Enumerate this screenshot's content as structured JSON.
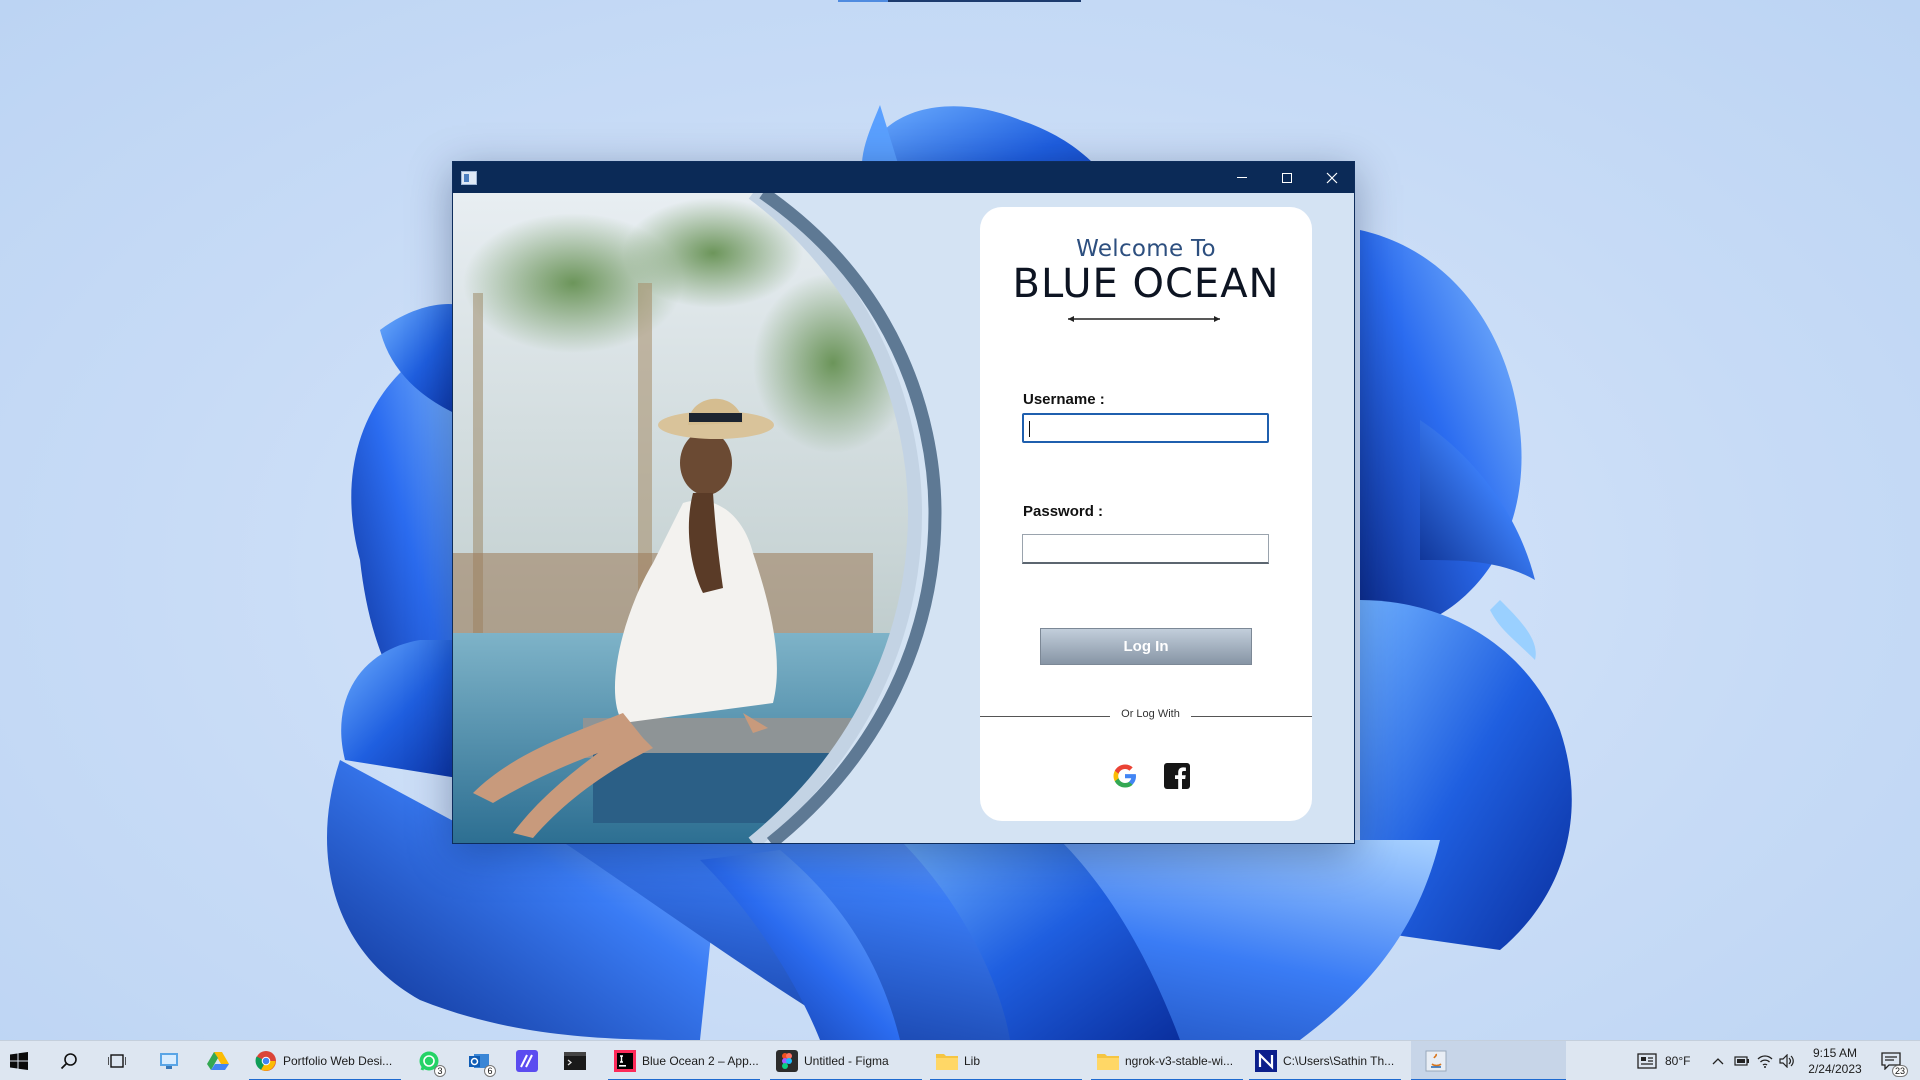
{
  "window": {
    "title": "",
    "controls": {
      "minimize": "minimize",
      "maximize": "maximize",
      "close": "close"
    }
  },
  "login": {
    "welcome_text": "Welcome To",
    "brand_name": "BLUE OCEAN",
    "username_label": "Username :",
    "username_value": "",
    "password_label": "Password :",
    "password_value": "",
    "login_button": "Log In",
    "or_text": "Or Log With",
    "social": [
      "google-icon",
      "facebook-icon"
    ]
  },
  "taskbar": {
    "pinned": [
      "start-icon",
      "search-icon",
      "task-view-icon",
      "file-explorer-icon",
      "google-drive-icon"
    ],
    "tasks": [
      {
        "icon": "chrome-icon",
        "label": "Portfolio Web Desi..."
      },
      {
        "icon": "whatsapp-icon",
        "badge": "3"
      },
      {
        "icon": "outlook-icon",
        "badge": "6"
      },
      {
        "icon": "app-icon"
      },
      {
        "icon": "terminal-icon"
      },
      {
        "icon": "intellij-icon",
        "label": "Blue Ocean 2 – App..."
      },
      {
        "icon": "figma-icon",
        "label": "Untitled - Figma"
      },
      {
        "icon": "folder-icon",
        "label": "Lib"
      },
      {
        "icon": "folder-icon",
        "label": "ngrok-v3-stable-wi..."
      },
      {
        "icon": "terminal-icon",
        "label": "C:\\Users\\Sathin Th..."
      },
      {
        "icon": "java-icon"
      }
    ],
    "weather": "80°F",
    "time": "9:15 AM",
    "date": "2/24/2023",
    "notifications": "23"
  }
}
